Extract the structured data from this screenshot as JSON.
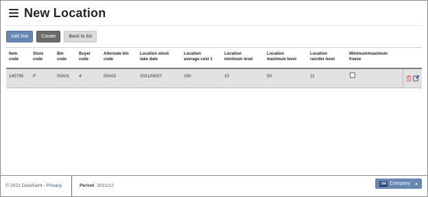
{
  "page": {
    "title": "New Location"
  },
  "toolbar": {
    "add_line": "Add line",
    "create": "Create",
    "back": "Back to list"
  },
  "table": {
    "columns": [
      [
        "Item",
        "code"
      ],
      [
        "Store",
        "code"
      ],
      [
        "Bin",
        "code"
      ],
      [
        "Buyer",
        "code"
      ],
      [
        "Alternate bin",
        "code"
      ],
      [
        "Location stock",
        "take date"
      ],
      [
        "Location",
        "average cost 1"
      ],
      [
        "Location",
        "minimum level"
      ],
      [
        "Location",
        "maximum level"
      ],
      [
        "Location",
        "reorder level"
      ],
      [
        "Minimum/maximum",
        "freeze"
      ]
    ],
    "row": {
      "item_code": "145785",
      "store_code": "P",
      "bin_code": "00A01",
      "buyer_code": "4",
      "alt_bin_code": "00A02",
      "stock_take_date": "2021/06/07",
      "avg_cost": "150",
      "min_level": "10",
      "max_level": "50",
      "reorder_level": "11",
      "freeze_checked": false
    }
  },
  "footer": {
    "copyright": "© 2021 DataSaint",
    "separator": " - ",
    "privacy": "Privacy",
    "period_label": "Period",
    "period_value": "2021/12",
    "company_badge": "OM",
    "company_label": "Company"
  },
  "colors": {
    "primary": "#6886b3",
    "dark_button": "#6c6c6c",
    "row_bg": "#e2e2e2",
    "delete_icon": "#e57373",
    "edit_icon": "#2b4f8a"
  },
  "icons": {
    "menu": "hamburger-icon",
    "delete": "trash-icon",
    "edit": "edit-icon",
    "company_caret": "caret-up-icon"
  }
}
